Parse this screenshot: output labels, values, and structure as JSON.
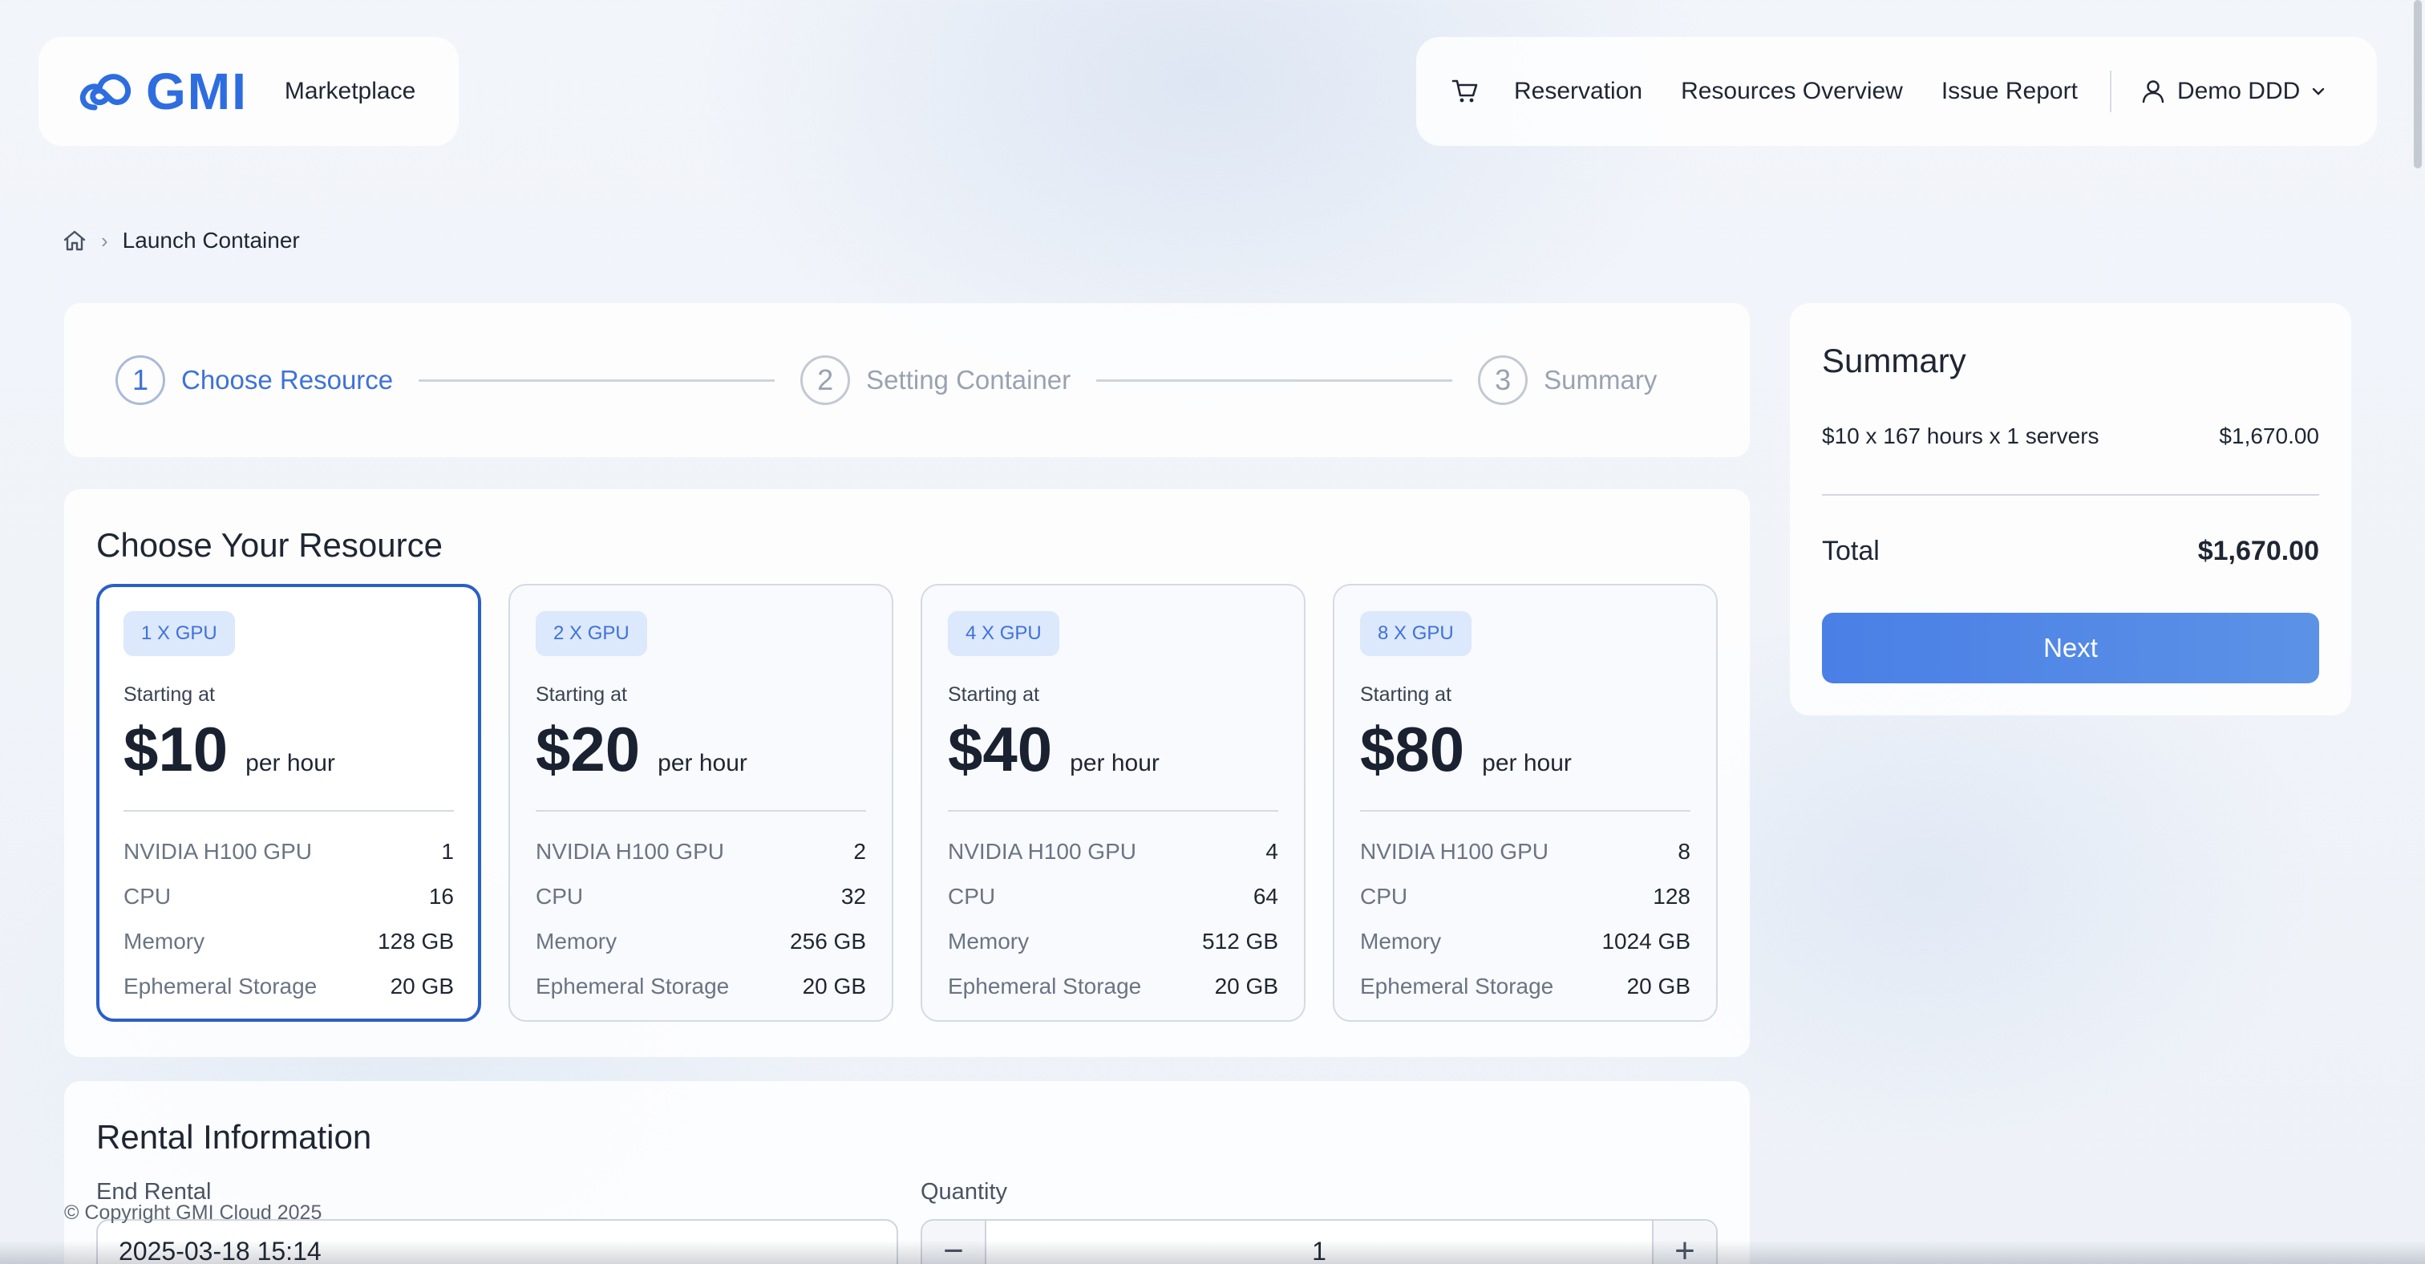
{
  "header": {
    "logo_text": "GMI",
    "section_label": "Marketplace",
    "nav": [
      "Reservation",
      "Resources Overview",
      "Issue Report"
    ],
    "user_name": "Demo DDD"
  },
  "breadcrumb": {
    "current": "Launch Container"
  },
  "stepper": [
    {
      "num": "1",
      "label": "Choose Resource",
      "active": true
    },
    {
      "num": "2",
      "label": "Setting Container",
      "active": false
    },
    {
      "num": "3",
      "label": "Summary",
      "active": false
    }
  ],
  "resource": {
    "title": "Choose Your Resource",
    "starting_label": "Starting at",
    "per_hour": "per hour",
    "spec_labels": [
      "NVIDIA H100 GPU",
      "CPU",
      "Memory",
      "Ephemeral Storage"
    ],
    "options": [
      {
        "badge": "1 X GPU",
        "price": "$10",
        "gpu": "1",
        "cpu": "16",
        "memory": "128 GB",
        "storage": "20 GB",
        "selected": true
      },
      {
        "badge": "2 X GPU",
        "price": "$20",
        "gpu": "2",
        "cpu": "32",
        "memory": "256 GB",
        "storage": "20 GB",
        "selected": false
      },
      {
        "badge": "4 X GPU",
        "price": "$40",
        "gpu": "4",
        "cpu": "64",
        "memory": "512 GB",
        "storage": "20 GB",
        "selected": false
      },
      {
        "badge": "8 X GPU",
        "price": "$80",
        "gpu": "8",
        "cpu": "128",
        "memory": "1024 GB",
        "storage": "20 GB",
        "selected": false
      }
    ]
  },
  "rental": {
    "title": "Rental Information",
    "end_label": "End Rental",
    "end_value": "2025-03-18 15:14",
    "quantity_label": "Quantity",
    "quantity_value": "1",
    "minus": "−",
    "plus": "+"
  },
  "footer": {
    "copyright": "© Copyright GMI Cloud 2025"
  },
  "summary": {
    "title": "Summary",
    "line_label": "$10 x 167 hours x 1 servers",
    "line_value": "$1,670.00",
    "total_label": "Total",
    "total_value": "$1,670.00",
    "next_label": "Next"
  },
  "colors": {
    "accent": "#3f72d8",
    "selected_border": "#2a5fc7",
    "badge_bg": "#dce8fb"
  }
}
